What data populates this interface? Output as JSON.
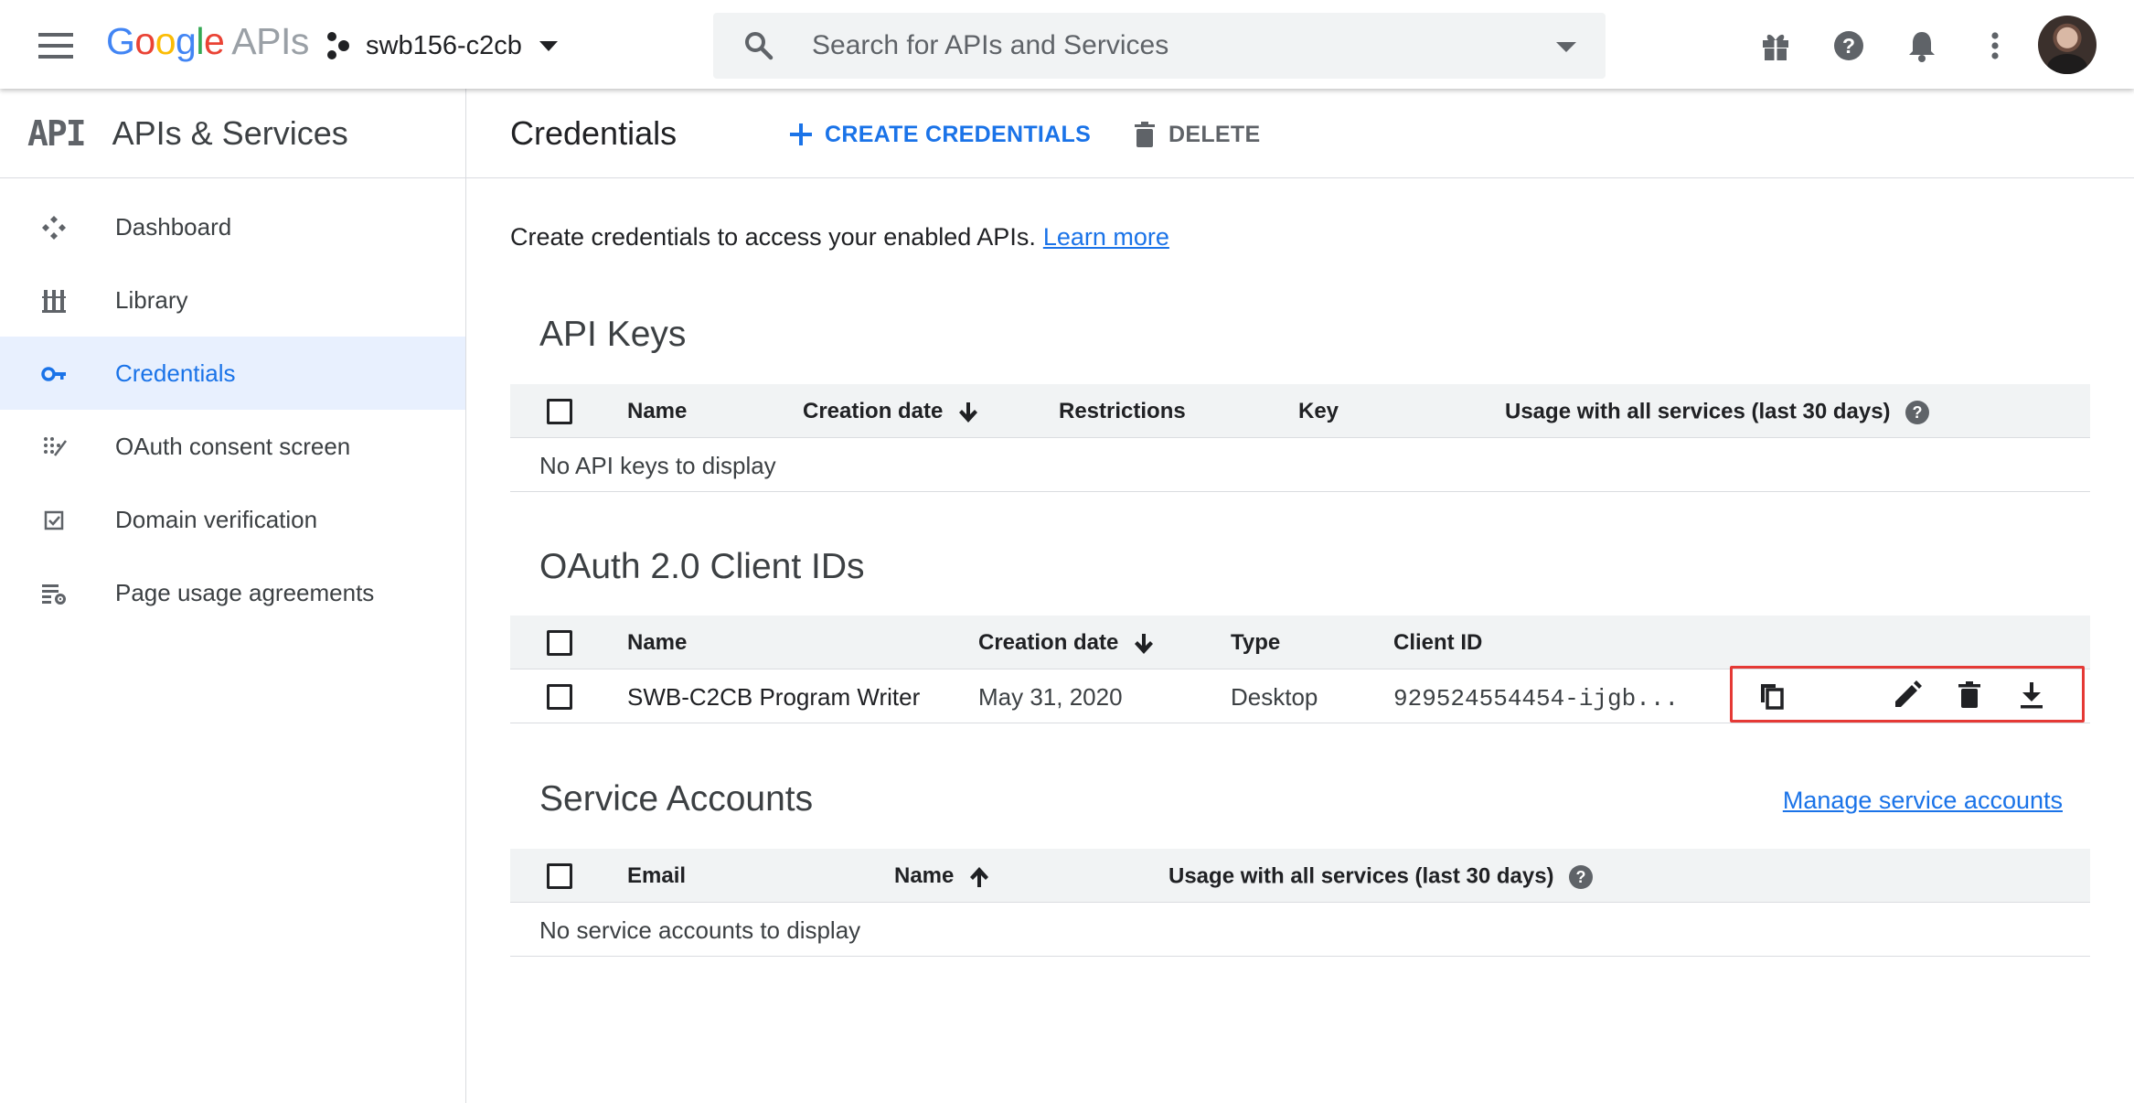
{
  "topbar": {
    "brand_letters": [
      "G",
      "o",
      "o",
      "g",
      "l",
      "e"
    ],
    "brand_suffix": "APIs",
    "project_name": "swb156-c2cb",
    "search_placeholder": "Search for APIs and Services",
    "icons": [
      "menu-icon",
      "project-icon",
      "search-icon",
      "gift-icon",
      "help-icon",
      "notifications-icon",
      "more-vert-icon"
    ]
  },
  "sidebar": {
    "logo": "API",
    "title": "APIs & Services",
    "items": [
      {
        "label": "Dashboard",
        "icon": "dashboard-icon"
      },
      {
        "label": "Library",
        "icon": "library-icon"
      },
      {
        "label": "Credentials",
        "icon": "key-icon",
        "active": true
      },
      {
        "label": "OAuth consent screen",
        "icon": "consent-icon"
      },
      {
        "label": "Domain verification",
        "icon": "checkbox-icon"
      },
      {
        "label": "Page usage agreements",
        "icon": "settings-list-icon"
      }
    ]
  },
  "header": {
    "title": "Credentials",
    "create_label": "CREATE CREDENTIALS",
    "delete_label": "DELETE"
  },
  "content": {
    "intro_text": "Create credentials to access your enabled APIs.",
    "learn_more": "Learn more",
    "api_keys": {
      "title": "API Keys",
      "columns": [
        "Name",
        "Creation date",
        "Restrictions",
        "Key",
        "Usage with all services (last 30 days)"
      ],
      "empty_text": "No API keys to display"
    },
    "oauth": {
      "title": "OAuth 2.0 Client IDs",
      "columns": [
        "Name",
        "Creation date",
        "Type",
        "Client ID"
      ],
      "rows": [
        {
          "name": "SWB-C2CB Program Writer",
          "date": "May 31, 2020",
          "type": "Desktop",
          "client_id": "929524554454-ijgb..."
        }
      ],
      "row_actions": [
        "copy-icon",
        "edit-icon",
        "delete-icon",
        "download-icon"
      ]
    },
    "service_accounts": {
      "title": "Service Accounts",
      "manage_link": "Manage service accounts",
      "columns": [
        "Email",
        "Name",
        "Usage with all services (last 30 days)"
      ],
      "empty_text": "No service accounts to display"
    }
  },
  "colors": {
    "accent": "#1a73e8",
    "active_bg": "#e8f0fe",
    "table_header_bg": "#f1f3f4",
    "highlight_box": "#e53935"
  }
}
